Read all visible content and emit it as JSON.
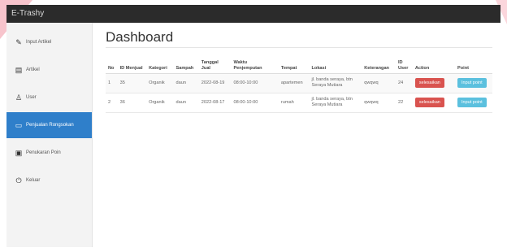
{
  "app_title": "E-Trashy",
  "sidebar": {
    "items": [
      {
        "label": "Input Artikel",
        "icon": "pencil-icon",
        "active": false
      },
      {
        "label": "Artikel",
        "icon": "document-icon",
        "active": false
      },
      {
        "label": "User",
        "icon": "user-icon",
        "active": false
      },
      {
        "label": "Penjualan Rongsokan",
        "icon": "card-icon",
        "active": true
      },
      {
        "label": "Penukaran Poin",
        "icon": "gift-icon",
        "active": false
      },
      {
        "label": "Keluar",
        "icon": "power-icon",
        "active": false
      }
    ]
  },
  "page_title": "Dashboard",
  "table": {
    "headers": [
      "No",
      "ID Menjual",
      "Kategori",
      "Sampah",
      "Tanggal Jual",
      "Waktu Penjemputan",
      "Tempat",
      "Lokasi",
      "Keterangan",
      "ID User",
      "Action",
      "Point"
    ],
    "rows": [
      [
        "1",
        "35",
        "Organik",
        "daun",
        "2022-08-19",
        "08:00-10:00",
        "apartemen",
        "jl. banda seraya, btn Seraya Mutiara",
        "qwqwq",
        "24"
      ],
      [
        "2",
        "36",
        "Organik",
        "daun",
        "2022-08-17",
        "08:00-10:00",
        "rumah",
        "jl. banda seraya, btn Seraya Mutiara",
        "qwqwq",
        "22"
      ]
    ],
    "action_label": "selesaikan",
    "point_label": "Input point"
  },
  "colors": {
    "topbar": "#2b2b2b",
    "active_nav": "#2f7fca",
    "danger": "#d9534f",
    "info": "#5bc0de"
  }
}
